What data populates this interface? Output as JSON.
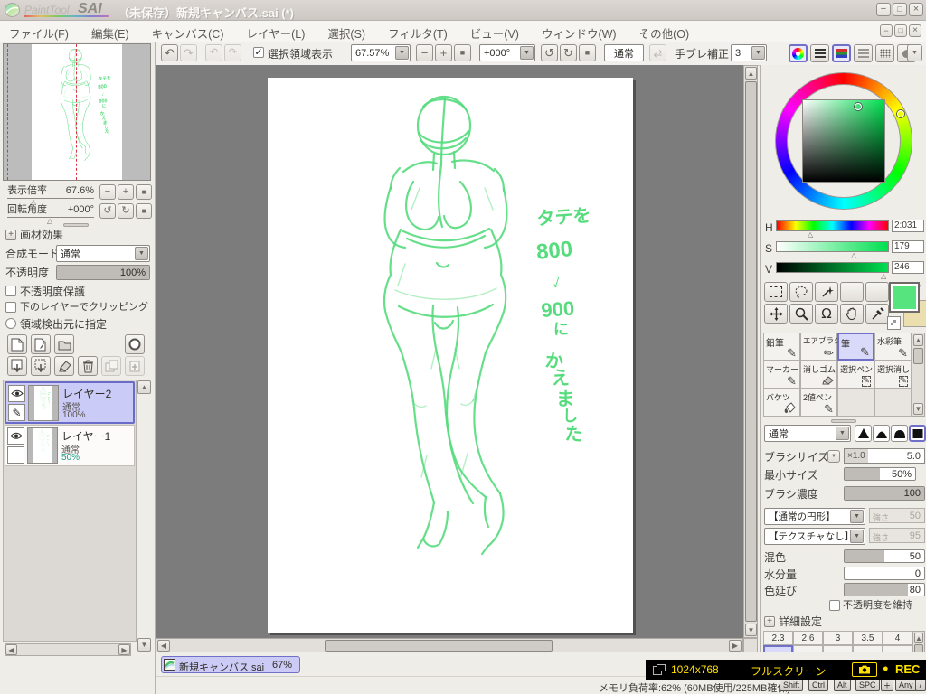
{
  "titlebar": {
    "brand1": "PaintTool",
    "brand2": "SAI",
    "title": "（未保存）新規キャンバス.sai (*)"
  },
  "menu": {
    "items": [
      "ファイル(F)",
      "編集(E)",
      "キャンバス(C)",
      "レイヤー(L)",
      "選択(S)",
      "フィルタ(T)",
      "ビュー(V)",
      "ウィンドウ(W)",
      "その他(O)"
    ]
  },
  "toolbar": {
    "selection_display": "選択領域表示",
    "zoom": "67.57%",
    "angle": "+000°",
    "blend": "通常",
    "stabilizer_label": "手ブレ補正",
    "stabilizer": "3"
  },
  "navigator": {
    "zoom_label": "表示倍率",
    "zoom": "67.6%",
    "angle_label": "回転角度",
    "angle": "+000°"
  },
  "layers": {
    "effects": "画材効果",
    "mode_label": "合成モード",
    "mode": "通常",
    "opacity_label": "不透明度",
    "opacity": "100%",
    "protect": "不透明度保護",
    "clip": "下のレイヤーでクリッピング",
    "source": "領域検出元に指定",
    "items": [
      {
        "name": "レイヤー2",
        "mode": "通常",
        "opacity": "100%"
      },
      {
        "name": "レイヤー1",
        "mode": "通常",
        "opacity": "50%"
      }
    ]
  },
  "color": {
    "h_label": "H",
    "h": "2:031",
    "s_label": "S",
    "s": "179",
    "v_label": "V",
    "v": "246",
    "foreground": "#55E47E",
    "background": "#EBDFB0"
  },
  "tools": {
    "names": [
      "鉛筆",
      "エアブラシ",
      "筆",
      "水彩筆",
      "マーカー",
      "消しゴム",
      "選択ペン",
      "選択消し",
      "バケツ",
      "2値ペン"
    ],
    "selected": "筆"
  },
  "brush": {
    "mode": "通常",
    "size_label": "ブラシサイズ",
    "size_scale": "×1.0",
    "size": "5.0",
    "min_label": "最小サイズ",
    "min": "50%",
    "density_label": "ブラシ濃度",
    "density": "100",
    "shape": "【通常の円形】",
    "strength_label": "強さ",
    "shape_strength": "50",
    "texture": "【テクスチャなし】",
    "texture_strength": "95",
    "mix_label": "混色",
    "mix": "50",
    "water_label": "水分量",
    "water": "0",
    "dilution_label": "色延び",
    "dilution": "80",
    "keep_opacity": "不透明度を維持",
    "advanced": "詳細設定"
  },
  "presets": {
    "labels": [
      "2.3",
      "2.6",
      "3",
      "3.5",
      "4"
    ],
    "selected": "2.3"
  },
  "annotation": {
    "lines": [
      "タテを",
      "800",
      "↓",
      "900",
      "に",
      "か",
      "え",
      "ま",
      "し",
      "た"
    ],
    "color": "#57DC7D"
  },
  "tab": {
    "name": "新規キャンバス.sai",
    "zoom": "67%"
  },
  "status": {
    "memory": "メモリ負荷率:62% (60MB使用/225MB確保)",
    "keys": [
      "Shift",
      "Ctrl",
      "Alt",
      "SPC"
    ],
    "any": "Any",
    "resolution": "1024x768",
    "fullscreen": "フルスクリーン",
    "rec": "REC"
  },
  "icons": {
    "dropdown": "▼",
    "minus": "−",
    "plus": "+",
    "stop": "■",
    "undo": "↶",
    "redo": "↷",
    "rotate_ccw": "↺",
    "rotate_cw": "↻",
    "swap": "⇄",
    "up": "▲",
    "down": "▼",
    "left": "◀",
    "right": "▶",
    "check": "✓",
    "rec_dot": "●",
    "close": "×",
    "minimize": "−",
    "maximize": "□",
    "pencil": "✎",
    "marker": "△"
  }
}
